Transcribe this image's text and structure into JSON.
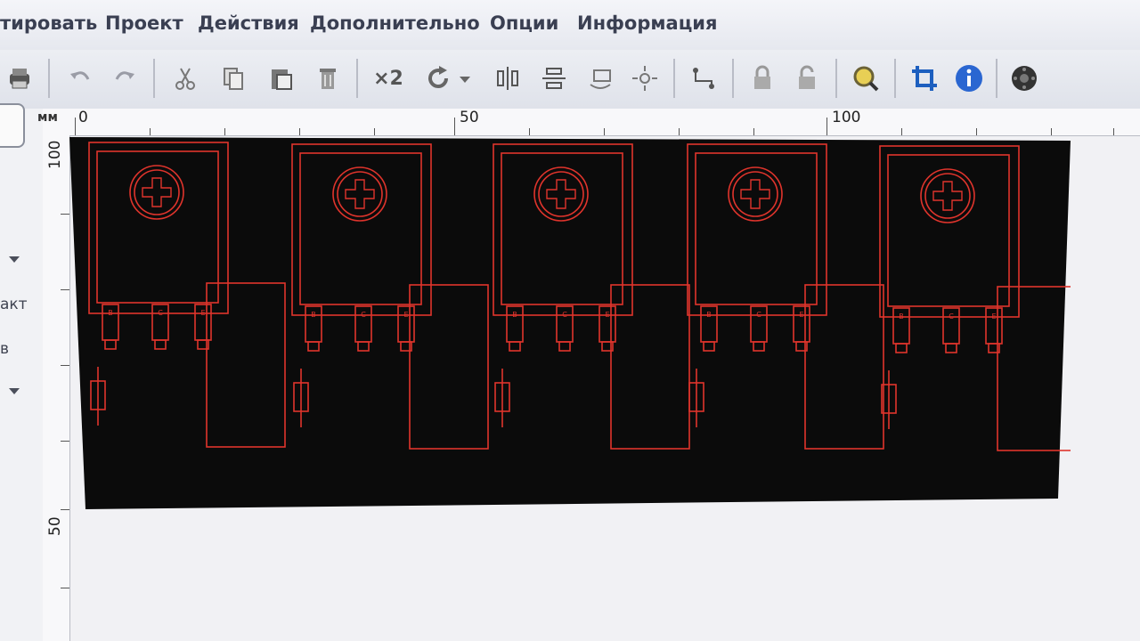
{
  "menu": [
    "тировать",
    "Проект",
    "Действия",
    "Дополнительно",
    "Опции",
    "Информация"
  ],
  "toolbar": {
    "icons": [
      "printer-icon",
      "undo-icon",
      "redo-icon",
      "cut-icon",
      "copy-icon",
      "paste-icon",
      "delete-icon",
      "duplicate-x2-icon",
      "rotate-icon",
      "rotate-dropdown-icon",
      "mirror-horizontal-icon",
      "mirror-vertical-icon",
      "flip-icon",
      "snap-icon",
      "connection-icon",
      "lock-icon",
      "unlock-icon",
      "zoom-icon",
      "crop-icon",
      "info-icon",
      "settings-icon"
    ],
    "duplicate_label": "×2"
  },
  "ruler": {
    "unit": "мм",
    "h_labels": [
      "0",
      "50",
      "100"
    ],
    "v_labels": [
      "100",
      "50"
    ]
  },
  "left_panel": {
    "label_1": "акт",
    "label_2": "в"
  },
  "colors": {
    "board_bg": "#0b0b0b",
    "trace_red": "#e0342c",
    "menu_text": "#3a3f52"
  },
  "board": {
    "module_count": 5,
    "pad_labels": [
      "B",
      "C",
      "E"
    ]
  }
}
